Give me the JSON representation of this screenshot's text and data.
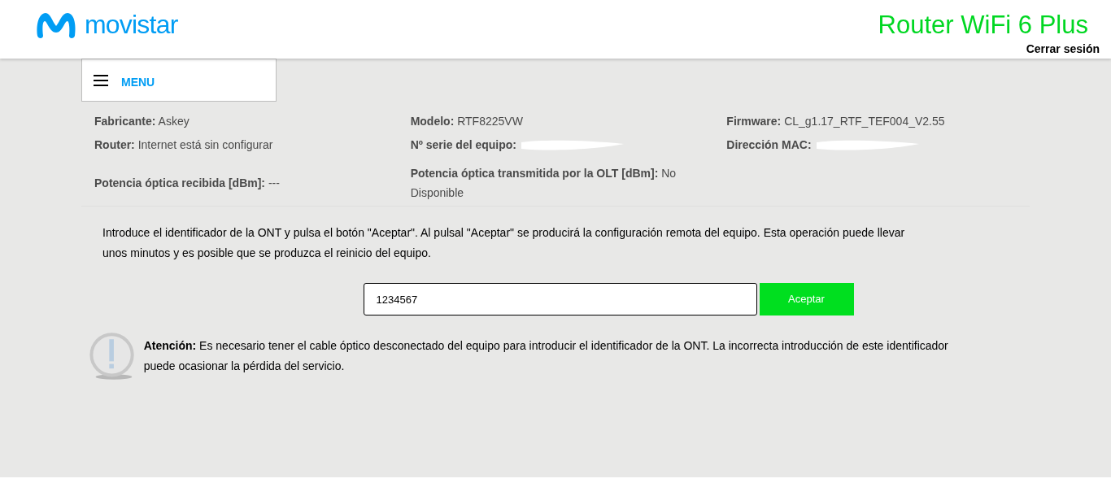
{
  "header": {
    "logo_text": "movistar",
    "title": "Router WiFi 6 Plus",
    "logout": "Cerrar sesión"
  },
  "menu": {
    "label": "MENU"
  },
  "info": [
    {
      "label": "Fabricante:",
      "value": "Askey"
    },
    {
      "label": "Modelo:",
      "value": "RTF8225VW"
    },
    {
      "label": "Firmware:",
      "value": "CL_g1.17_RTF_TEF004_V2.55"
    },
    {
      "label": "Router:",
      "value": "Internet está sin configurar"
    },
    {
      "label": "Nº serie del equipo:",
      "redacted": true
    },
    {
      "label": "Dirección MAC:",
      "redacted": true
    },
    {
      "label": "Potencia óptica recibida [dBm]:",
      "value": "---"
    },
    {
      "label": "Potencia óptica transmitida por la OLT [dBm]:",
      "value": "No Disponible"
    }
  ],
  "instructions": "Introduce el identificador de la ONT y pulsa el botón \"Aceptar\". Al pulsal \"Aceptar\" se producirá la configuración remota del equipo. Esta operación puede llevar unos minutos y es posible que se produzca el reinicio del equipo.",
  "ont_field": {
    "value": "1234567"
  },
  "accept_button": "Aceptar",
  "warning": "**Atención:** Es necesario tener el cable óptico desconectado del equipo para introducir el identificador de la ONT. La incorrecta introducción de este identificador puede ocasionar la pérdida del servicio."
}
